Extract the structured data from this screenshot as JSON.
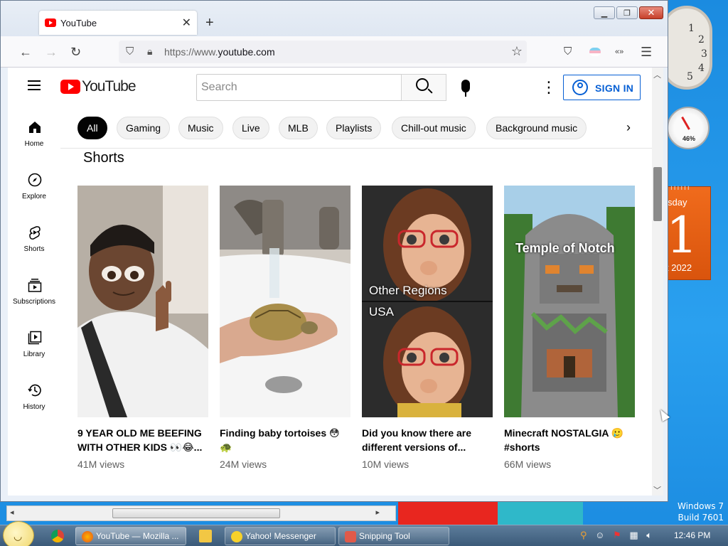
{
  "browser": {
    "tab_title": "YouTube",
    "url_prefix": "https://www.",
    "url_domain": "youtube.com",
    "new_tab_glyph": "+",
    "tab_close_glyph": "✕"
  },
  "youtube": {
    "logo_text": "YouTube",
    "search_placeholder": "Search",
    "sign_in": "SIGN IN",
    "chips": [
      "All",
      "Gaming",
      "Music",
      "Live",
      "MLB",
      "Playlists",
      "Chill-out music",
      "Background music"
    ],
    "sidebar": [
      {
        "label": "Home",
        "icon": "home-icon"
      },
      {
        "label": "Explore",
        "icon": "compass-icon"
      },
      {
        "label": "Shorts",
        "icon": "shorts-icon"
      },
      {
        "label": "Subscriptions",
        "icon": "subscriptions-icon"
      },
      {
        "label": "Library",
        "icon": "library-icon"
      },
      {
        "label": "History",
        "icon": "history-icon"
      }
    ],
    "section_title": "Shorts",
    "shorts": [
      {
        "title": "9 YEAR OLD ME BEEFING WITH OTHER KIDS 👀😂...",
        "views": "41M views"
      },
      {
        "title": "Finding baby tortoises 😳 🐢",
        "views": "24M views"
      },
      {
        "title": "Did you know there are different versions of...",
        "views": "10M views",
        "overlay_1": "Other Regions",
        "overlay_2": "USA"
      },
      {
        "title": "Minecraft NOSTALGIA 🥲 #shorts",
        "views": "66M views",
        "overlay_1": "Temple of Notch"
      }
    ]
  },
  "desktop": {
    "watermark_line1": "Windows 7",
    "watermark_line2": "Build 7601",
    "calendar_day": "sday",
    "calendar_date": "1",
    "calendar_month": "t 2022",
    "meter_percent": "46%",
    "clock_numbers": [
      "1",
      "2",
      "3",
      "4",
      "5"
    ]
  },
  "taskbar": {
    "items": [
      {
        "label": "YouTube — Mozilla ...",
        "icon": "firefox-icon"
      },
      {
        "label": "Yahoo! Messenger",
        "icon": "yahoo-messenger-icon"
      },
      {
        "label": "Snipping Tool",
        "icon": "snipping-tool-icon"
      }
    ],
    "time": "12:46 PM"
  },
  "colors": {
    "yt_red": "#ff0000",
    "signin_blue": "#065fd4",
    "desktop_blue": "#1b8be0"
  }
}
